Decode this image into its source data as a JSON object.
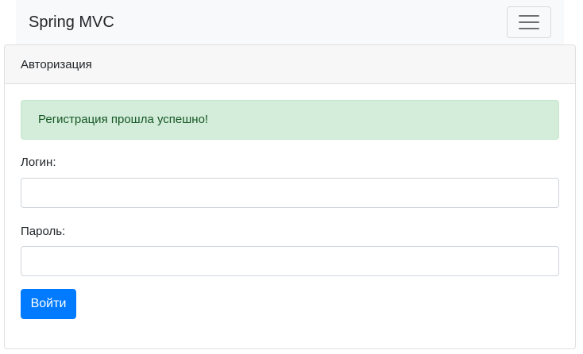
{
  "navbar": {
    "brand": "Spring MVC",
    "toggler_icon": "hamburger-icon"
  },
  "card": {
    "header": "Авторизация",
    "alert": {
      "message": "Регистрация прошла успешно!"
    },
    "form": {
      "login_label": "Логин:",
      "login_value": "",
      "password_label": "Пароль:",
      "password_value": "",
      "submit_label": "Войти"
    }
  },
  "colors": {
    "navbar_bg": "#f8f9fa",
    "primary": "#007bff",
    "success_bg": "#d4edda",
    "success_text": "#155724",
    "card_header_bg": "#f7f7f7"
  }
}
